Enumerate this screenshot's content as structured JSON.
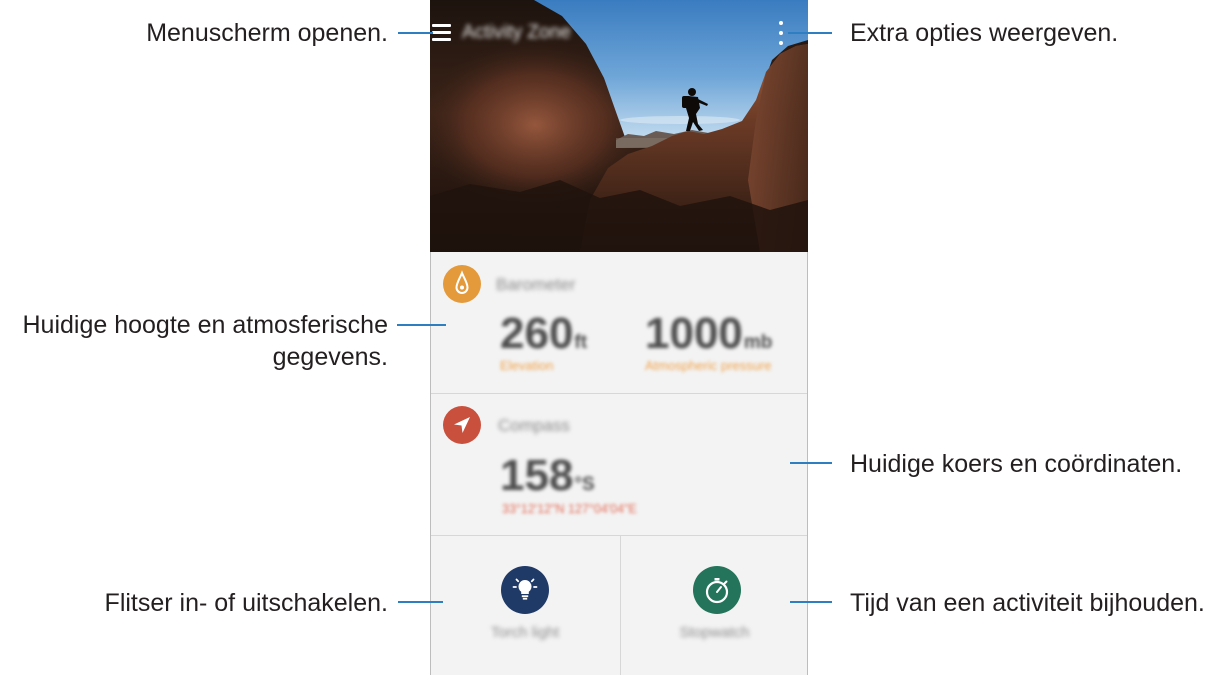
{
  "callouts": {
    "menu": "Menuscherm openen.",
    "more_options": "Extra opties weergeven.",
    "altitude_atmosphere": [
      "Huidige hoogte en atmosferische",
      "gegevens."
    ],
    "heading_coordinates": "Huidige koers en coördinaten.",
    "flash_toggle": "Flitser in- of uitschakelen.",
    "activity_timer": "Tijd van een activiteit bijhouden."
  },
  "screen": {
    "app_title": "Activity Zone",
    "header_icons": [
      "hamburger-menu-icon",
      "more-options-icon"
    ],
    "barometer": {
      "label": "Barometer",
      "icon": "barometer-icon",
      "elevation": {
        "value": "260",
        "unit": "ft",
        "label": "Elevation"
      },
      "pressure": {
        "value": "1000",
        "unit": "mb",
        "label": "Atmospheric pressure"
      }
    },
    "compass": {
      "label": "Compass",
      "icon": "navigation-arrow-icon",
      "heading": {
        "value": "158",
        "unit": "°S"
      },
      "coordinates": "33°12'12\"N 127°04'04\"E"
    },
    "torch": {
      "label": "Torch light",
      "icon": "lightbulb-icon"
    },
    "stopwatch": {
      "label": "Stopwatch",
      "icon": "stopwatch-icon"
    }
  },
  "colors": {
    "callout_line": "#2d7fc1",
    "barometer_icon": "#e49a3a",
    "compass_icon": "#c9503c",
    "torch_icon": "#203a68",
    "stopwatch_icon": "#23745a",
    "elevation_text": "#f0a24a",
    "coordinates_text": "#e46a55"
  }
}
